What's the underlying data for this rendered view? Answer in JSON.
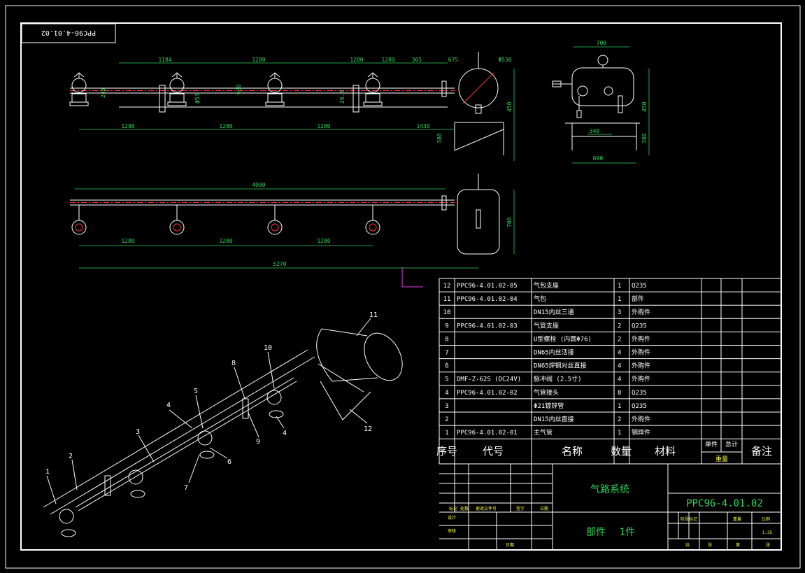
{
  "drawing_code_mirrored": "PPC96-4.01.02",
  "dimensions": {
    "top_upper": [
      "1184",
      "1280",
      "1280",
      "1280",
      "305",
      "675",
      "Φ530"
    ],
    "top_lower": [
      "1280",
      "1280",
      "1280",
      "1430"
    ],
    "top_vertical": [
      "245",
      "Φ53",
      "Φ30",
      "26.5",
      "450",
      "380"
    ],
    "side": [
      "700",
      "450",
      "380",
      "340",
      "690"
    ],
    "plan": [
      "4900",
      "1280",
      "1280",
      "1280",
      "5270",
      "700"
    ]
  },
  "callouts": [
    "1",
    "2",
    "3",
    "4",
    "5",
    "6",
    "7",
    "8",
    "9",
    "10",
    "4",
    "11",
    "12"
  ],
  "bom": {
    "rows": [
      {
        "no": "12",
        "code": "PPC96-4.01.02-05",
        "name": "气包支座",
        "qty": "1",
        "material": "Q235",
        "remark": ""
      },
      {
        "no": "11",
        "code": "PPC96-4.01.02-04",
        "name": "气包",
        "qty": "1",
        "material": "部件",
        "remark": ""
      },
      {
        "no": "10",
        "code": "",
        "name": "DN15内丝三通",
        "qty": "3",
        "material": "外购件",
        "remark": ""
      },
      {
        "no": "9",
        "code": "PPC96-4.01.02-03",
        "name": "气管支座",
        "qty": "2",
        "material": "Q235",
        "remark": ""
      },
      {
        "no": "8",
        "code": "",
        "name": "U型螺栓 (内圆Φ76)",
        "qty": "2",
        "material": "外购件",
        "remark": ""
      },
      {
        "no": "7",
        "code": "",
        "name": "DN65内丝活接",
        "qty": "4",
        "material": "外购件",
        "remark": ""
      },
      {
        "no": "6",
        "code": "",
        "name": "DN65焊钢对丝直接",
        "qty": "4",
        "material": "外购件",
        "remark": ""
      },
      {
        "no": "5",
        "code": "DMF-Z-62S (DC24V)",
        "name": "脉冲阀 (2.5寸)",
        "qty": "4",
        "material": "外购件",
        "remark": ""
      },
      {
        "no": "4",
        "code": "PPC96-4.01.02-02",
        "name": "气管接头",
        "qty": "8",
        "material": "Q235",
        "remark": ""
      },
      {
        "no": "3",
        "code": "",
        "name": "Φ21镀锌管",
        "qty": "1",
        "material": "Q235",
        "remark": ""
      },
      {
        "no": "2",
        "code": "",
        "name": "DN15内丝直接",
        "qty": "2",
        "material": "外购件",
        "remark": ""
      },
      {
        "no": "1",
        "code": "PPC96-4.01.02-01",
        "name": "主气管",
        "qty": "1",
        "material": "钢焊件",
        "remark": ""
      }
    ],
    "header": {
      "no": "序号",
      "code": "代号",
      "name": "名称",
      "qty": "数量",
      "material": "材料",
      "unit_weight": "单件",
      "total_weight": "总计",
      "weight": "重量",
      "remark": "备注"
    }
  },
  "title_block": {
    "title": "气路系统",
    "drawing_no": "PPC96-4.01.02",
    "subtitle_part": "部件",
    "subtitle_qty": "1件",
    "rev_labels": [
      "标记",
      "处数",
      "更改文件号",
      "签字",
      "日期"
    ],
    "sign_labels": [
      "设计",
      "审核",
      "日期"
    ],
    "stage_labels": [
      "阶段标记",
      "重量",
      "比例"
    ],
    "scale": "1:35",
    "sheet_labels": [
      "共",
      "张",
      "第",
      "张"
    ]
  }
}
